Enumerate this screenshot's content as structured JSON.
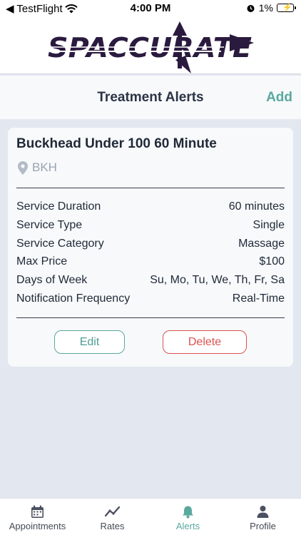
{
  "status_bar": {
    "back_app": "◀ TestFlight",
    "time": "4:00 PM",
    "battery": "1%"
  },
  "brand": {
    "logo_text": "SPACCURATE"
  },
  "header": {
    "title": "Treatment Alerts",
    "add_label": "Add"
  },
  "alert": {
    "name": "Buckhead Under 100 60 Minute",
    "location": "BKH",
    "details": [
      {
        "label": "Service Duration",
        "value": "60 minutes"
      },
      {
        "label": "Service Type",
        "value": "Single"
      },
      {
        "label": "Service Category",
        "value": "Massage"
      },
      {
        "label": "Max Price",
        "value": "$100"
      },
      {
        "label": "Days of Week",
        "value": "Su, Mo, Tu, We, Th, Fr, Sa"
      },
      {
        "label": "Notification Frequency",
        "value": "Real-Time"
      }
    ],
    "edit_label": "Edit",
    "delete_label": "Delete"
  },
  "tabs": [
    {
      "label": "Appointments",
      "icon": "calendar-icon",
      "active": false
    },
    {
      "label": "Rates",
      "icon": "trend-icon",
      "active": false
    },
    {
      "label": "Alerts",
      "icon": "bell-icon",
      "active": true
    },
    {
      "label": "Profile",
      "icon": "person-icon",
      "active": false
    }
  ],
  "colors": {
    "accent": "#59a99e",
    "danger": "#d9534f",
    "logo": "#2a1a3e",
    "background": "#e3e8f0"
  }
}
